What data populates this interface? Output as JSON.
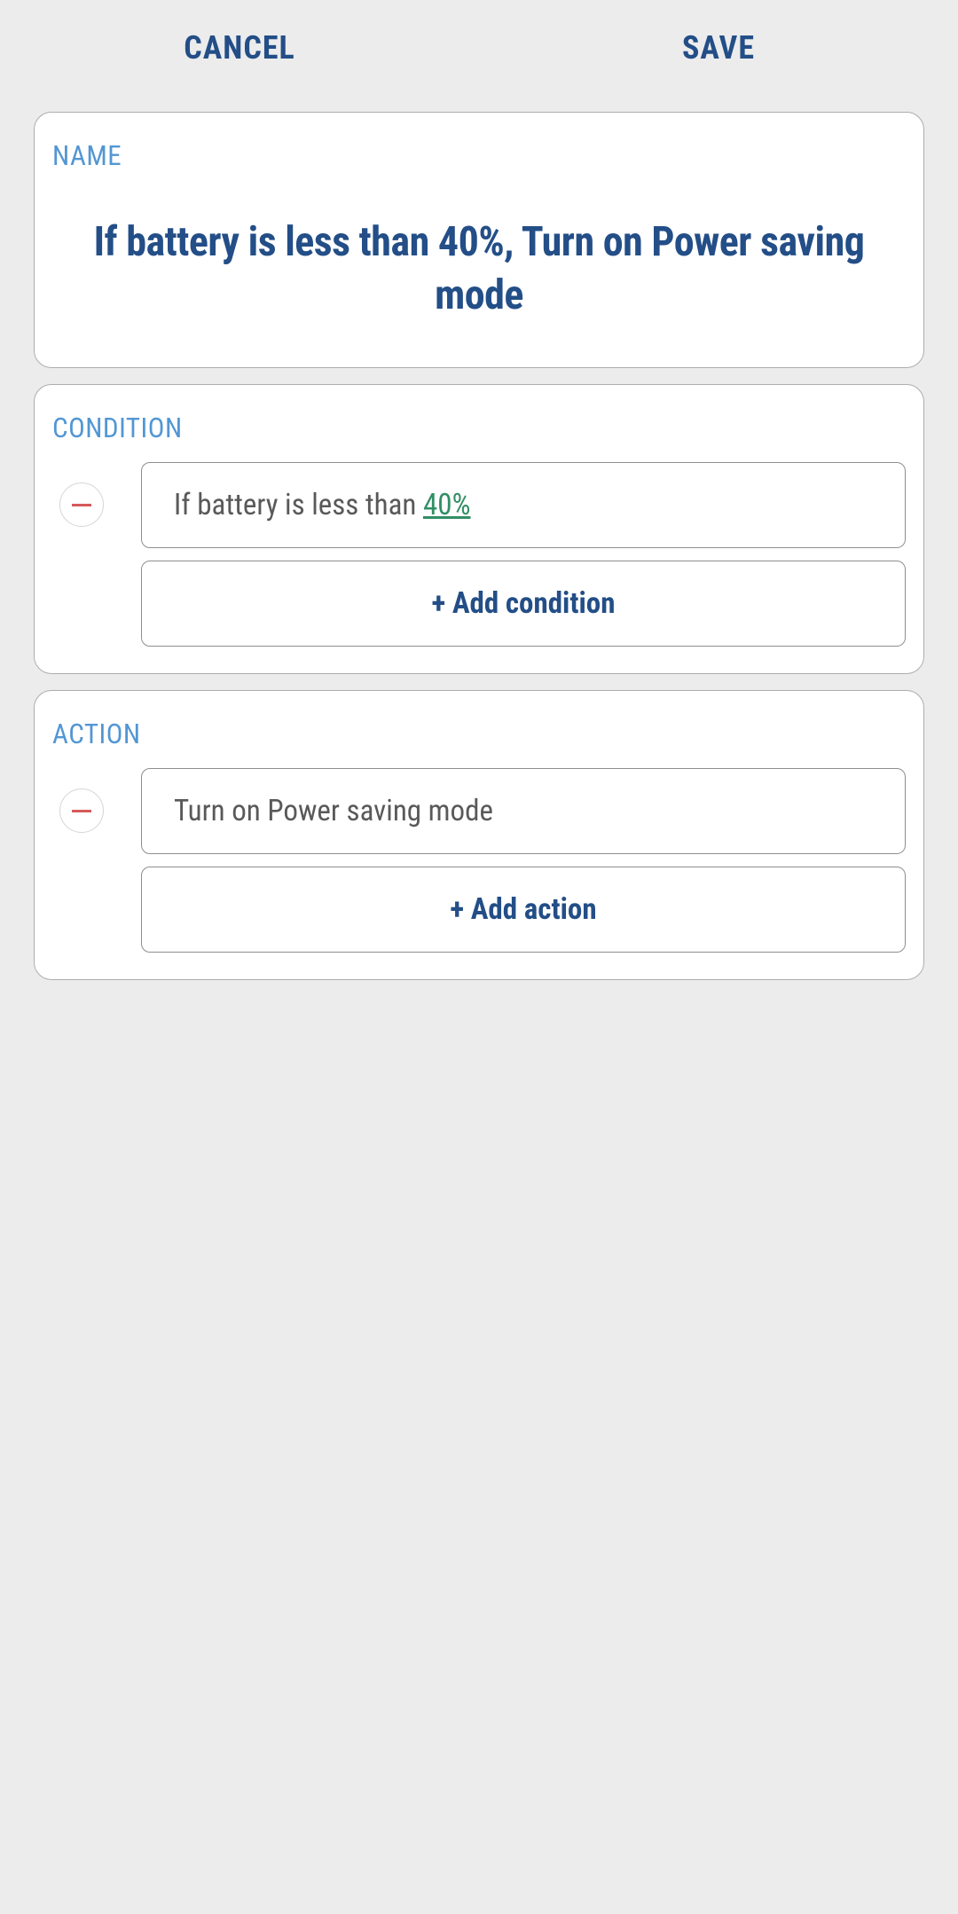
{
  "header": {
    "cancel_label": "CANCEL",
    "save_label": "SAVE"
  },
  "name_section": {
    "label": "NAME",
    "value": "If battery is less than 40%, Turn on Power saving mode"
  },
  "condition_section": {
    "label": "CONDITION",
    "items": [
      {
        "prefix": "If battery is less than ",
        "link_value": "40%"
      }
    ],
    "add_label": "+ Add condition"
  },
  "action_section": {
    "label": "ACTION",
    "items": [
      {
        "text": "Turn on Power saving mode"
      }
    ],
    "add_label": "+ Add action"
  }
}
